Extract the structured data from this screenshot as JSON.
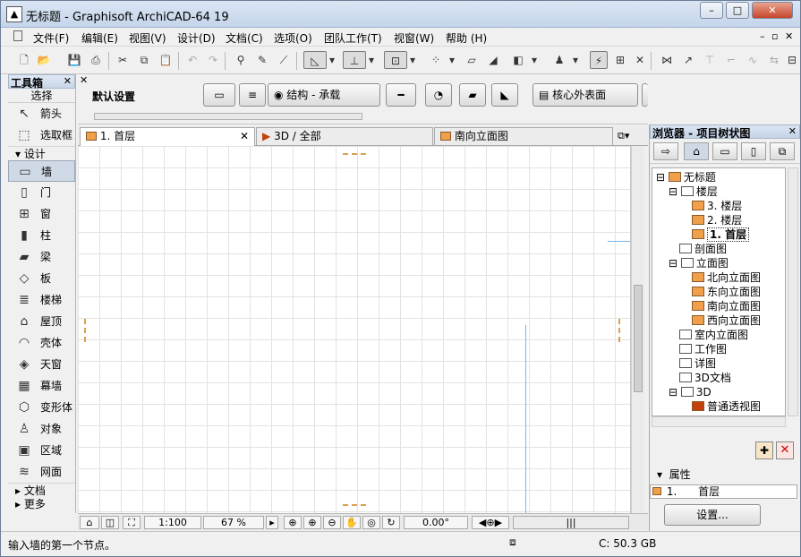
{
  "window": {
    "title": "无标题 - Graphisoft ArchiCAD-64 19",
    "minimize": "–",
    "maximize": "□",
    "close": "✕"
  },
  "menubar": {
    "items": [
      "文件(F)",
      "编辑(E)",
      "视图(V)",
      "设计(D)",
      "文档(C)",
      "选项(O)",
      "团队工作(T)",
      "视窗(W)",
      "帮助 (H)"
    ],
    "mdi_controls": [
      "–",
      "▫",
      "✕"
    ]
  },
  "toolbox": {
    "title": "工具箱",
    "close": "✕",
    "select_header": "选择",
    "select_tools": [
      {
        "label": "箭头",
        "icon": "arrow-pointer-icon",
        "glyph": "↖"
      },
      {
        "label": "选取框",
        "icon": "marquee-icon",
        "glyph": "⬚"
      }
    ],
    "design_header": "设计",
    "design_tools": [
      {
        "label": "墙",
        "icon": "wall-icon",
        "glyph": "▭",
        "selected": true
      },
      {
        "label": "门",
        "icon": "door-icon",
        "glyph": "▯"
      },
      {
        "label": "窗",
        "icon": "window-icon",
        "glyph": "⊞"
      },
      {
        "label": "柱",
        "icon": "column-icon",
        "glyph": "▮"
      },
      {
        "label": "梁",
        "icon": "beam-icon",
        "glyph": "▰"
      },
      {
        "label": "板",
        "icon": "slab-icon",
        "glyph": "◇"
      },
      {
        "label": "楼梯",
        "icon": "stair-icon",
        "glyph": "≣"
      },
      {
        "label": "屋顶",
        "icon": "roof-icon",
        "glyph": "⌂"
      },
      {
        "label": "壳体",
        "icon": "shell-icon",
        "glyph": "◠"
      },
      {
        "label": "天窗",
        "icon": "skylight-icon",
        "glyph": "◈"
      },
      {
        "label": "幕墙",
        "icon": "curtain-wall-icon",
        "glyph": "▦"
      },
      {
        "label": "变形体",
        "icon": "morph-icon",
        "glyph": "⬡"
      },
      {
        "label": "对象",
        "icon": "object-icon",
        "glyph": "♙"
      },
      {
        "label": "区域",
        "icon": "zone-icon",
        "glyph": "▣"
      },
      {
        "label": "网面",
        "icon": "mesh-icon",
        "glyph": "≋"
      }
    ],
    "document_header": "文档",
    "more_header": "更多"
  },
  "infobox": {
    "label": "默认设置",
    "structure": "结构 - 承载",
    "surface": "核心外表面"
  },
  "tabs": [
    {
      "label": "1. 首层",
      "close": "✕"
    },
    {
      "label": "3D / 全部"
    },
    {
      "label": "南向立面图"
    }
  ],
  "navigator": {
    "scale": "1:100",
    "zoom": "67 %",
    "angle": "0.00°"
  },
  "status": {
    "prompt": "输入墙的第一个节点。",
    "coord": "C: 50.3 GB"
  },
  "browser": {
    "title": "浏览器 - 项目树状图",
    "close": "✕",
    "tree": [
      {
        "label": "无标题",
        "level": 0,
        "icon": "project-icon"
      },
      {
        "label": "楼层",
        "level": 1,
        "icon": "folder-icon"
      },
      {
        "label": "3. 楼层",
        "level": 2,
        "icon": "story-icon"
      },
      {
        "label": "2. 楼层",
        "level": 2,
        "icon": "story-icon"
      },
      {
        "label": "1. 首层",
        "level": 2,
        "icon": "story-icon",
        "selected": true
      },
      {
        "label": "剖面图",
        "level": 1,
        "icon": "section-icon"
      },
      {
        "label": "立面图",
        "level": 1,
        "icon": "elevation-icon"
      },
      {
        "label": "北向立面图",
        "level": 2,
        "icon": "elevation-view-icon"
      },
      {
        "label": "东向立面图",
        "level": 2,
        "icon": "elevation-view-icon"
      },
      {
        "label": "南向立面图",
        "level": 2,
        "icon": "elevation-view-icon"
      },
      {
        "label": "西向立面图",
        "level": 2,
        "icon": "elevation-view-icon"
      },
      {
        "label": "室内立面图",
        "level": 1,
        "icon": "interior-elevation-icon"
      },
      {
        "label": "工作图",
        "level": 1,
        "icon": "worksheet-icon"
      },
      {
        "label": "详图",
        "level": 1,
        "icon": "detail-icon"
      },
      {
        "label": "3D文档",
        "level": 1,
        "icon": "3d-document-icon"
      },
      {
        "label": "3D",
        "level": 1,
        "icon": "3d-icon"
      },
      {
        "label": "普通透视图",
        "level": 2,
        "icon": "camera-icon"
      }
    ],
    "properties_title": "属性",
    "property_id": "1.",
    "property_name": "首层",
    "settings_button": "设置..."
  }
}
